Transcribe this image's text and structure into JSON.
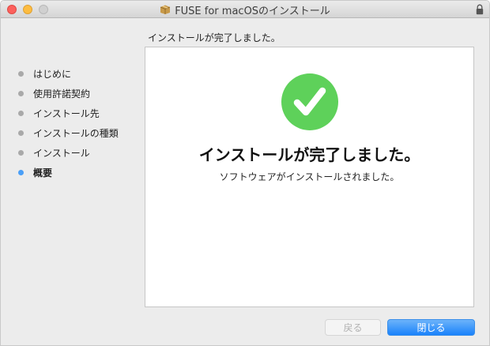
{
  "window": {
    "title": "FUSE for macOSのインストール"
  },
  "heading_small": "インストールが完了しました。",
  "steps": [
    {
      "label": "はじめに",
      "active": false
    },
    {
      "label": "使用許諾契約",
      "active": false
    },
    {
      "label": "インストール先",
      "active": false
    },
    {
      "label": "インストールの種類",
      "active": false
    },
    {
      "label": "インストール",
      "active": false
    },
    {
      "label": "概要",
      "active": true
    }
  ],
  "panel": {
    "main_message": "インストールが完了しました。",
    "sub_message": "ソフトウェアがインストールされました。"
  },
  "buttons": {
    "back_label": "戻る",
    "close_label": "閉じる"
  },
  "icons": {
    "package": "package-icon",
    "lock": "lock-icon",
    "success": "checkmark-icon"
  },
  "colors": {
    "accent": "#1a82fb",
    "success": "#5ed15a",
    "active_step": "#4a9ff7"
  }
}
